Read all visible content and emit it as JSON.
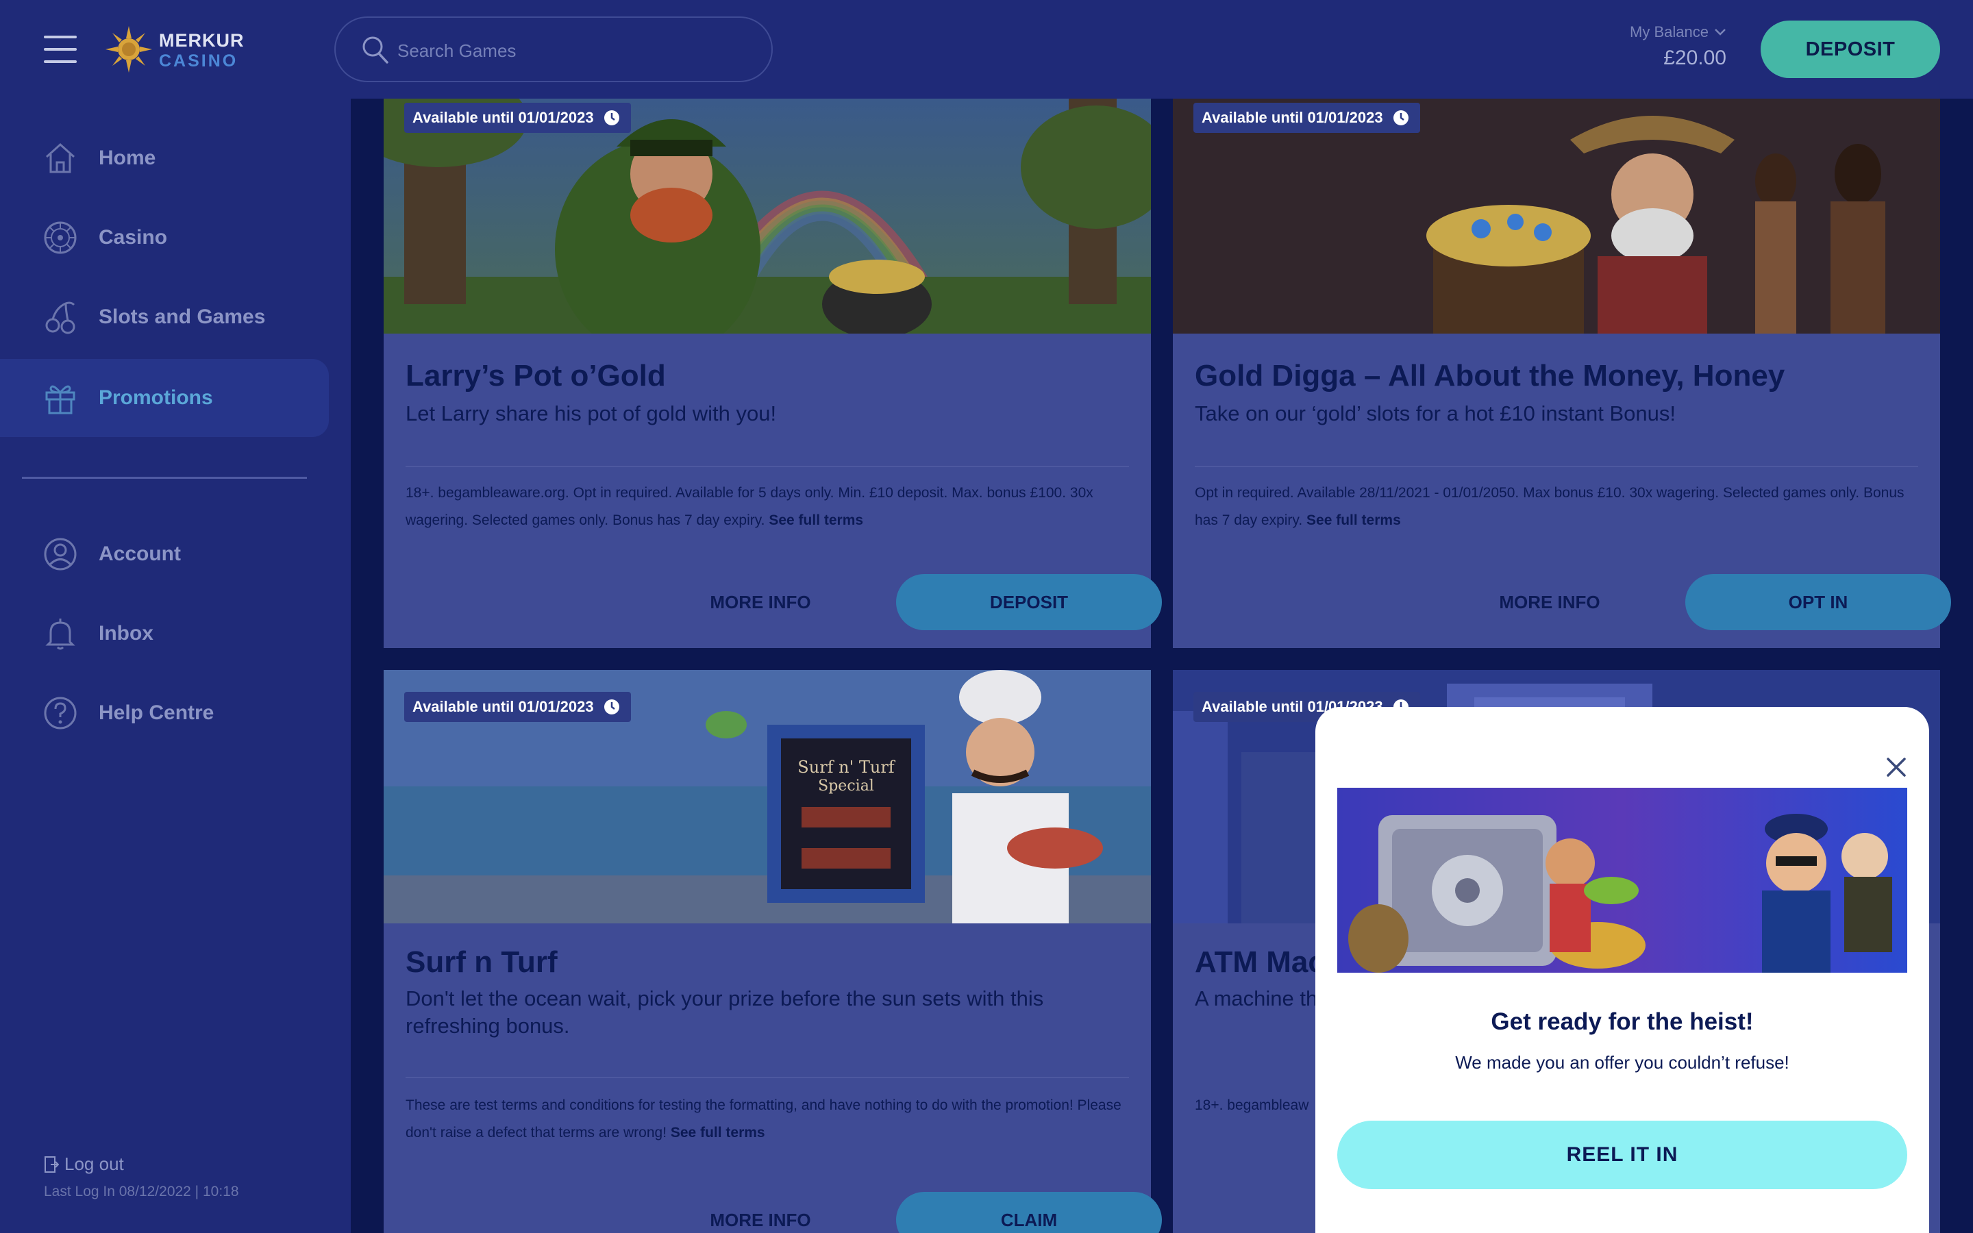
{
  "header": {
    "logo": {
      "line1": "MERKUR",
      "line2": "CASINO"
    },
    "search": {
      "placeholder": "Search Games"
    },
    "balance": {
      "label": "My Balance",
      "value": "£20.00"
    },
    "deposit_label": "DEPOSIT"
  },
  "sidebar": {
    "items": [
      {
        "label": "Home",
        "icon": "home-icon"
      },
      {
        "label": "Casino",
        "icon": "roulette-icon"
      },
      {
        "label": "Slots and Games",
        "icon": "cherries-icon"
      },
      {
        "label": "Promotions",
        "icon": "gift-icon",
        "active": true
      },
      {
        "label": "Account",
        "icon": "user-icon"
      },
      {
        "label": "Inbox",
        "icon": "bell-icon"
      },
      {
        "label": "Help Centre",
        "icon": "help-icon"
      }
    ],
    "logout_label": "Log out",
    "last_login": "Last Log In 08/12/2022 | 10:18"
  },
  "promotions": [
    {
      "available": "Available until 01/01/2023",
      "title": "Larry’s Pot o’Gold",
      "subtitle": "Let Larry share his pot of gold with you!",
      "terms": "18+. begambleaware.org. Opt in required. Available for 5 days only. Min. £10 deposit. Max. bonus £100. 30x wagering. Selected games only. Bonus has 7 day expiry.",
      "terms_link": "See full terms",
      "more_info": "MORE INFO",
      "cta": "DEPOSIT"
    },
    {
      "available": "Available until 01/01/2023",
      "title": "Gold Digga – All About the Money, Honey",
      "subtitle": "Take on our ‘gold’ slots for a hot £10 instant Bonus!",
      "terms": "Opt in required. Available 28/11/2021 - 01/01/2050. Max bonus £10. 30x wagering. Selected games only. Bonus has 7 day expiry.",
      "terms_link": "See full terms",
      "more_info": "MORE INFO",
      "cta": "OPT IN"
    },
    {
      "available": "Available until 01/01/2023",
      "title": "Surf n Turf",
      "subtitle": "Don't let the ocean wait, pick your prize before the sun sets with this refreshing bonus.",
      "terms": "These are test terms and conditions for testing the formatting, and have nothing to do with the promotion! Please don't raise a defect that terms are wrong!",
      "terms_link": "See full terms",
      "more_info": "MORE INFO",
      "cta": "CLAIM",
      "board_line1": "Surf n' Turf",
      "board_line2": "Special"
    },
    {
      "available": "Available until 01/01/2023",
      "title": "ATM Mac",
      "subtitle": "A machine th",
      "terms": "18+. begambleaw"
    }
  ],
  "modal": {
    "title": "Get ready for the heist!",
    "text": "We made you an offer you couldn’t refuse!",
    "button": "REEL IT IN"
  },
  "colors": {
    "background": "#0c1750",
    "sidebar": "#1f2a78",
    "accent_teal": "#45b7a6",
    "cta_blue": "#2f7eb2",
    "modal_button": "#8ef1f4",
    "text_dark": "#0c1a55"
  }
}
